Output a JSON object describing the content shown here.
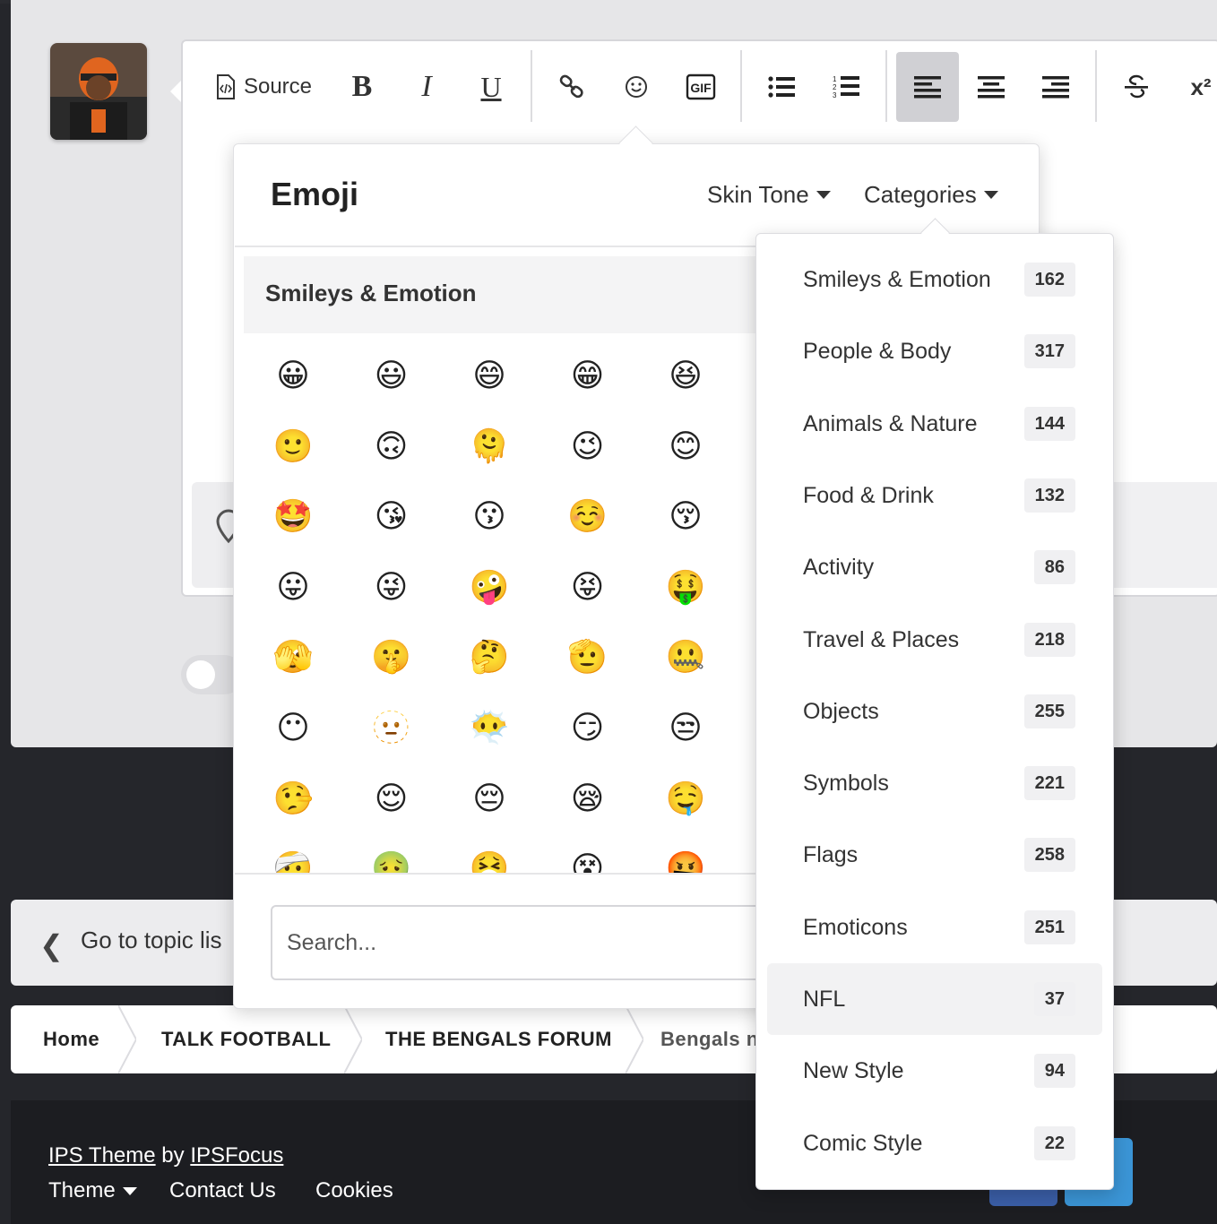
{
  "toolbar": {
    "source_label": "Source",
    "bold_label": "B",
    "italic_label": "I",
    "underline_label": "U",
    "superscript_label": "x²"
  },
  "emoji_panel": {
    "title": "Emoji",
    "skin_tone_label": "Skin Tone",
    "categories_label": "Categories",
    "section_title": "Smileys & Emotion",
    "search_placeholder": "Search...",
    "emojis": [
      "😀",
      "😃",
      "😄",
      "😁",
      "😆",
      "🙂",
      "🙃",
      "🫠",
      "😉",
      "😊",
      "🤩",
      "😘",
      "😗",
      "☺️",
      "😚",
      "😛",
      "😜",
      "🤪",
      "😝",
      "🤑",
      "🫣",
      "🤫",
      "🤔",
      "🫡",
      "🤐",
      "😶",
      "🫥",
      "😶‍🌫️",
      "😏",
      "😒",
      "🤥",
      "😌",
      "😔",
      "😪",
      "🤤",
      "🤕",
      "🤢",
      "🤮",
      "😵",
      "🤬"
    ]
  },
  "categories_menu": {
    "items": [
      {
        "label": "Smileys & Emotion",
        "count": "162"
      },
      {
        "label": "People & Body",
        "count": "317"
      },
      {
        "label": "Animals & Nature",
        "count": "144"
      },
      {
        "label": "Food & Drink",
        "count": "132"
      },
      {
        "label": "Activity",
        "count": "86"
      },
      {
        "label": "Travel & Places",
        "count": "218"
      },
      {
        "label": "Objects",
        "count": "255"
      },
      {
        "label": "Symbols",
        "count": "221"
      },
      {
        "label": "Flags",
        "count": "258"
      },
      {
        "label": "Emoticons",
        "count": "251"
      },
      {
        "label": "NFL",
        "count": "37"
      },
      {
        "label": "New Style",
        "count": "94"
      },
      {
        "label": "Comic Style",
        "count": "22"
      }
    ],
    "active_item": "NFL"
  },
  "topic_nav": {
    "label": "Go to topic lis"
  },
  "breadcrumb": {
    "items": [
      "Home",
      "TALK FOOTBALL",
      "THE BENGALS FORUM",
      "Bengals n"
    ]
  },
  "footer": {
    "theme_credit_1": "IPS Theme",
    "theme_credit_by": "by",
    "theme_credit_2": "IPSFocus",
    "theme_label": "Theme",
    "contact_label": "Contact Us",
    "cookies_label": "Cookies"
  },
  "colors": {
    "accent_facebook": "#3b5fa8",
    "accent_twitter": "#3b95d6",
    "page_dark": "#25262b"
  }
}
